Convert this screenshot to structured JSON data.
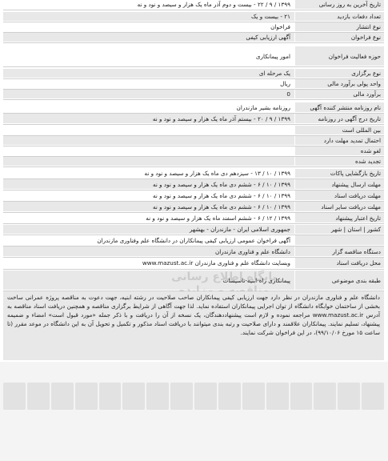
{
  "rows": [
    {
      "label": "تاریخ آخرین به روز رسانی",
      "value": "۱۳۹۹ / ۹ / ۲۲ - بیست و دوم آذر ماه یک هزار و سیصد و نود و نه"
    },
    {
      "label": "تعداد دفعات بازدید",
      "value": "۲۱ - بیست و یک"
    },
    {
      "label": "نوع انتشار",
      "value": "فراخوان"
    },
    {
      "label": "نوع فراخوان",
      "value": "آگهی ارزیابی کیفی"
    },
    {
      "label": "حوزه فعالیت فراخوان",
      "value": "امور پیمانکاری"
    },
    {
      "label": "نوع برگزاری",
      "value": "یک مرحله ای"
    },
    {
      "label": "واحد پولی برآورد مالی",
      "value": "ریال"
    },
    {
      "label": "برآورد مالی",
      "value": "0"
    },
    {
      "label": "نام روزنامه منتشر کننده آگهی",
      "value": "روزنامه بشیر مازندران"
    },
    {
      "label": "تاریخ درج آگهی در روزنامه",
      "value": "۱۳۹۹ / ۹ / ۲۰ - بیستم آذر ماه یک هزار و سیصد و نود و نه"
    },
    {
      "label": "بین المللی است",
      "value": ""
    },
    {
      "label": "احتمال تمدید مهلت دارد",
      "value": ""
    },
    {
      "label": "لغو شده",
      "value": ""
    },
    {
      "label": "تجدید شده",
      "value": ""
    },
    {
      "label": "تاریخ بازگشایی پاکات",
      "value": "۱۳۹۹ / ۱۰ / ۱۳ - سیزدهم دی ماه یک هزار و سیصد و نود و نه"
    },
    {
      "label": "مهلت ارسال پیشنهاد",
      "value": "۱۳۹۹ / ۱۰ / ۶ - ششم دی ماه یک هزار و سیصد و نود و نه"
    },
    {
      "label": "مهلت دریافت اسناد",
      "value": "۱۳۹۹ / ۱۰ / ۶ - ششم دی ماه یک هزار و سیصد و نود و نه"
    },
    {
      "label": "مهلت دریافت سایر اسناد",
      "value": "۱۳۹۹ / ۱۰ / ۶ - ششم دی ماه یک هزار و سیصد و نود و نه"
    },
    {
      "label": "تاریخ اعتبار پیشنهاد",
      "value": "۱۳۹۹ / ۱۲ / ۶ - ششم اسفند ماه یک هزار و سیصد و نود و نه"
    },
    {
      "label": "کشور | استان | شهر",
      "value": "جمهوری اسلامی ایران - مازندران - بهشهر"
    },
    {
      "label": "",
      "value": "آگهی فراخوان عمومی ارزیابی کیفی پیمانکاران در دانشگاه علم وفناوری مازندران"
    },
    {
      "label": "دستگاه مناقصه گزار",
      "value": "دانشگاه علم و فناوری مازندران"
    },
    {
      "label": "محل دریافت اسناد",
      "value": "وبسایت دانشگاه علم و فناوری مازندران www.mazust.ac.ir"
    },
    {
      "label": "طبقه بندی موضوعی",
      "value": "پیمانکاری راه-ابنیه-تاسیسات"
    }
  ],
  "description": "دانشگاه علم و فناوری مازندران در نظر دارد جهت ارزیابی کیفی پیمانکاران صاحب صلاحیت در رشته ابنیه، جهت دعوت به مناقصه پروژه عمرانی ساخت بخشی از ساختمان خوابگاه دانشگاه از توان اجرایی پیمانکاران استفاده نماید. لذا جهت آگاهی از شرایط برگزاری مناقصه و همچنین دریافت اسناد مناقصه به آدرس www.mazust.ac.ir مراجعه نموده و لازم است پیشنهاددهندگان، یک نسخه از آن را دریافت و با ذکر جمله «مورد قبول است» امضاء و ضمیمه پیشنهاد، تسلیم نمایند. پیمانکاران علاقمند و دارای صلاحیت و رتبه بندی میتوانند با دریافت اسناد مذکور و تکمیل و تحویل آن به این دانشگاه در موعد مقرر (تا ساعت ۱۵ مورخ ۹۹/۱۰/۰۶)، در این فراخوان شرکت نمایند.",
  "watermark": "پایگاه اطلاع رسانی مناقصه و مزایده"
}
